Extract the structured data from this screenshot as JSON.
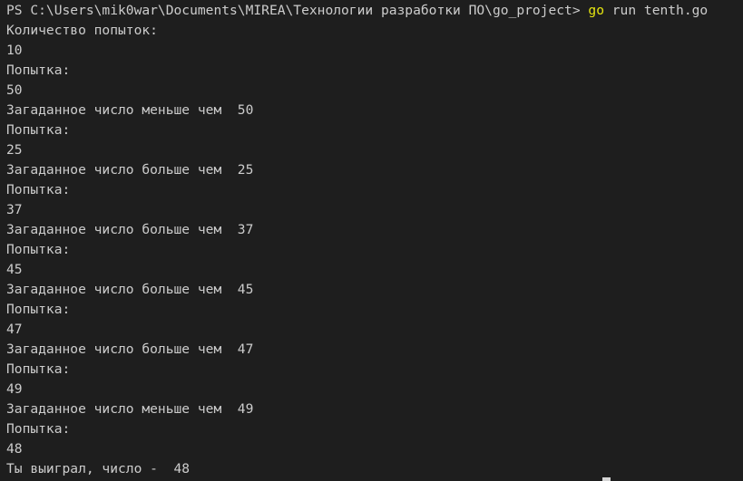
{
  "terminal": {
    "prompt": "PS C:\\Users\\mik0war\\Documents\\MIREA\\Технологии разработки ПО\\go_project> ",
    "command_keyword": "go",
    "command_args": " run tenth.go",
    "lines": [
      "Количество попыток:",
      "10",
      "Попытка:",
      "50",
      "Загаданное число меньше чем  50",
      "Попытка:",
      "25",
      "Загаданное число больше чем  25",
      "Попытка:",
      "37",
      "Загаданное число больше чем  37",
      "Попытка:",
      "45",
      "Загаданное число больше чем  45",
      "Попытка:",
      "47",
      "Загаданное число больше чем  47",
      "Попытка:",
      "49",
      "Загаданное число меньше чем  49",
      "Попытка:",
      "48",
      "Ты выиграл, число -  48"
    ]
  }
}
